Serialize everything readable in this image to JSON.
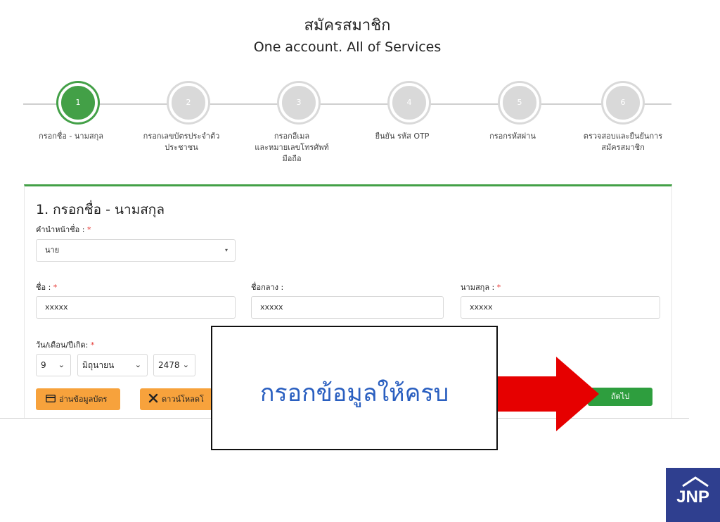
{
  "header": {
    "title": "สมัครสมาชิก",
    "subtitle": "One account. All of Services"
  },
  "steps": [
    {
      "number": "1",
      "label": "กรอกชื่อ - นามสกุล",
      "active": true
    },
    {
      "number": "2",
      "label": "กรอกเลขบัตรประจำตัว\nประชาชน",
      "active": false
    },
    {
      "number": "3",
      "label": "กรอกอีเมล\nและหมายเลขโทรศัพท์\nมือถือ",
      "active": false
    },
    {
      "number": "4",
      "label": "ยืนยัน รหัส OTP",
      "active": false
    },
    {
      "number": "5",
      "label": "กรอกรหัสผ่าน",
      "active": false
    },
    {
      "number": "6",
      "label": "ตรวจสอบและยืนยันการ\nสมัครสมาชิก",
      "active": false
    }
  ],
  "form": {
    "section_title": "1. กรอกชื่อ - นามสกุล",
    "prefix_label": "คำนำหน้าชื่อ : ",
    "prefix_value": "นาย",
    "first_name_label": "ชื่อ : ",
    "first_name_value": "xxxxx",
    "middle_name_label": "ชื่อกลาง :",
    "middle_name_value": "xxxxx",
    "last_name_label": "นามสกุล : ",
    "last_name_value": "xxxxx",
    "dob_label": "วัน/เดือน/ปีเกิด: ",
    "dob_day": "9",
    "dob_month": "มิถุนายน",
    "dob_year": "2478",
    "required_mark": "*",
    "dropdown_caret": "▾",
    "select_chevron": "⌄"
  },
  "buttons": {
    "read_card": "อ่านข้อมูลบัตร",
    "download": "ดาวน์โหลดโ",
    "next": "ถัดไป"
  },
  "callout": {
    "text": "กรอกข้อมูลให้ครบ"
  },
  "logo": {
    "text": "JNP"
  },
  "colors": {
    "accent_green": "#43a047",
    "button_orange": "#f7a23c",
    "arrow_red": "#e60000",
    "callout_blue": "#2a5fc0",
    "logo_navy": "#2f3f8f"
  }
}
